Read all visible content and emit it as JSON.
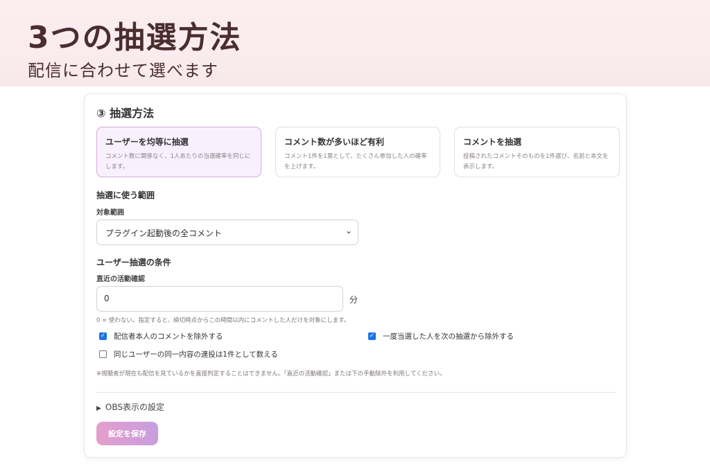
{
  "hero": {
    "title": "3つの抽選方法",
    "subtitle": "配信に合わせて選べます"
  },
  "card": {
    "title": "③ 抽選方法",
    "options": [
      {
        "title": "ユーザーを均等に抽選",
        "desc": "コメント数に関係なく、1人あたりの当選確率を同じにします。",
        "selected": true
      },
      {
        "title": "コメント数が多いほど有利",
        "desc": "コメント1件を1票として、たくさん参加した人の確率を上げます。",
        "selected": false
      },
      {
        "title": "コメントを抽選",
        "desc": "投稿されたコメントそのものを1件選び、名前と本文を表示します。",
        "selected": false
      }
    ],
    "range_section": "抽選に使う範囲",
    "range_label": "対象範囲",
    "range_value": "プラグイン起動後の全コメント",
    "cond_section": "ユーザー抽選の条件",
    "activity_label": "直近の活動確認",
    "activity_value": "0",
    "activity_unit": "分",
    "activity_hint": "0 = 使わない。指定すると、締切時点からこの時間以内にコメントした人だけを対象にします。",
    "checkboxes": [
      {
        "label": "配信者本人のコメントを除外する",
        "checked": true
      },
      {
        "label": "一度当選した人を次の抽選から除外する",
        "checked": true
      },
      {
        "label": "同じユーザーの同一内容の連投は1件として数える",
        "checked": false
      }
    ],
    "note": "※視聴者が現在も配信を見ているかを直接判定することはできません。「直近の活動確認」または下の手動除外を利用してください。",
    "obs_settings": "OBS表示の設定",
    "save_label": "設定を保存"
  },
  "colors": {
    "hero_bg": "#fbeef0",
    "selected_border": "#d9a6e0",
    "checkbox_blue": "#1a73e8",
    "save_gradient_start": "#e49fcb",
    "save_gradient_end": "#c89ddf"
  },
  "icons": {
    "select_chevron": "chevron-down-icon",
    "details_toggle": "triangle-right-icon",
    "checkmark": "check-icon"
  }
}
